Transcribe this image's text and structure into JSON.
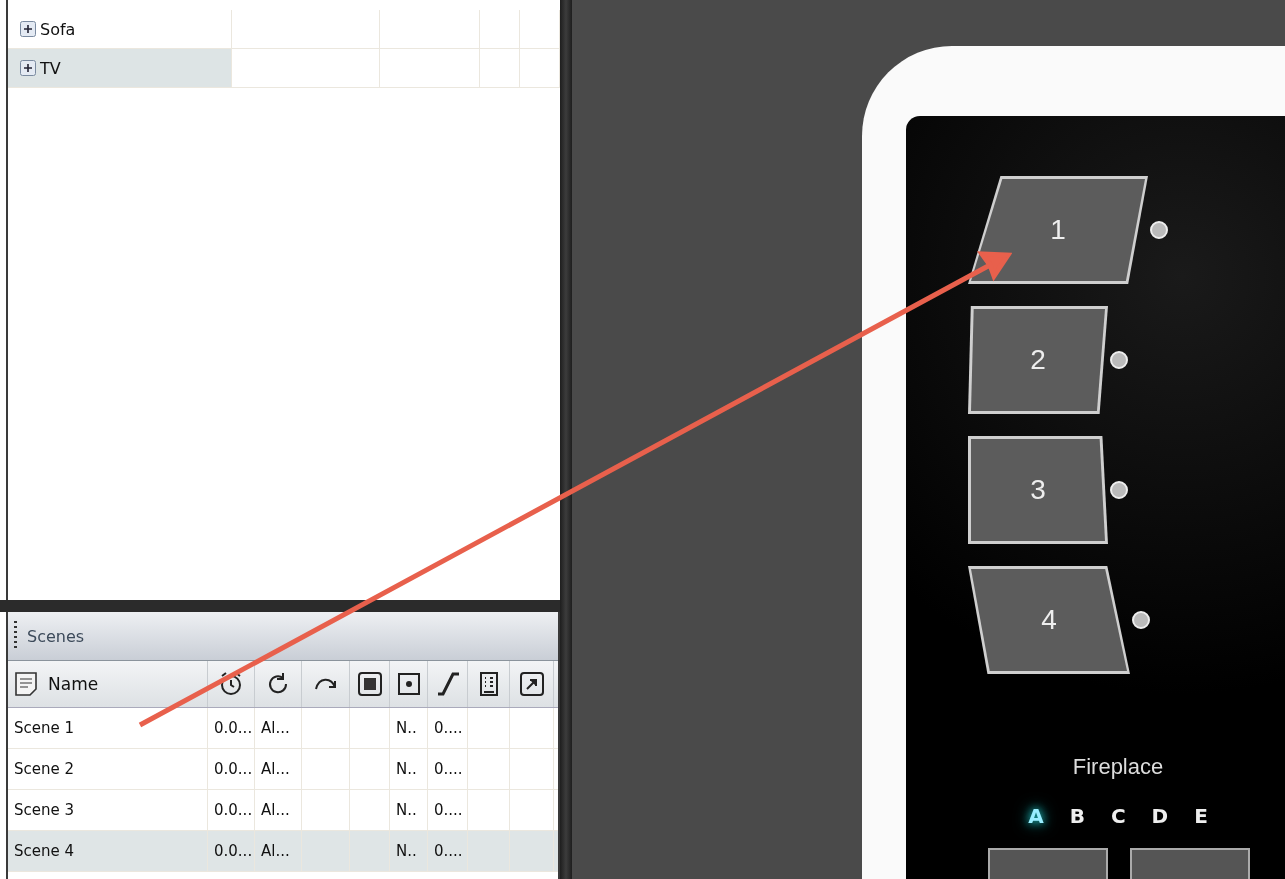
{
  "tree": {
    "items": [
      {
        "label": "Sofa",
        "expanded": false,
        "selected": false
      },
      {
        "label": "TV",
        "expanded": false,
        "selected": true
      }
    ]
  },
  "scenes_panel": {
    "title": "Scenes",
    "columns": [
      {
        "kind": "name",
        "label": "Name"
      },
      {
        "kind": "alarm"
      },
      {
        "kind": "repeat"
      },
      {
        "kind": "curve"
      },
      {
        "kind": "stop"
      },
      {
        "kind": "dot"
      },
      {
        "kind": "ramp"
      },
      {
        "kind": "list"
      },
      {
        "kind": "pointer"
      }
    ],
    "rows": [
      {
        "name": "Scene 1",
        "column_2": "0.0...",
        "column_3": "Al...",
        "column_6": "N..",
        "column_7": "0....",
        "selected": false
      },
      {
        "name": "Scene 2",
        "column_2": "0.0...",
        "column_3": "Al...",
        "column_6": "N..",
        "column_7": "0....",
        "selected": false
      },
      {
        "name": "Scene 3",
        "column_2": "0.0...",
        "column_3": "Al...",
        "column_6": "N..",
        "column_7": "0....",
        "selected": false
      },
      {
        "name": "Scene 4",
        "column_2": "0.0...",
        "column_3": "Al...",
        "column_6": "N..",
        "column_7": "0....",
        "selected": true
      }
    ]
  },
  "keypad": {
    "buttons": [
      {
        "label": "1"
      },
      {
        "label": "2"
      },
      {
        "label": "3"
      },
      {
        "label": "4"
      }
    ],
    "zone": "Fireplace",
    "banks": [
      {
        "label": "A",
        "selected": true
      },
      {
        "label": "B",
        "selected": false
      },
      {
        "label": "C",
        "selected": false
      },
      {
        "label": "D",
        "selected": false
      },
      {
        "label": "E",
        "selected": false
      }
    ]
  }
}
